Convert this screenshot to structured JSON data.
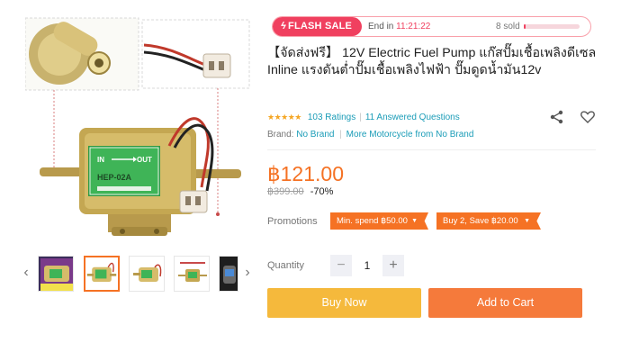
{
  "flash_sale": {
    "label": "FLASH SALE",
    "icon": "bolt-icon",
    "end_in_label": "End in",
    "timer": "11:21:22",
    "sold_text": "8 sold",
    "sold_fraction": 0.03,
    "accent_color": "#f0405f"
  },
  "product": {
    "title": "【จัดส่งฟรี】 12V Electric Fuel Pump แก๊สปั๊มเชื้อเพลิงดีเซล Inline แรงดันต่ำปั๊มเชื้อเพลิงไฟฟ้า ปั๊มดูดน้ำมัน12v",
    "rating_value": 4.5,
    "ratings_text": "103 Ratings",
    "questions_text": "11 Answered Questions",
    "brand_label": "Brand:",
    "brand_value": "No Brand",
    "more_link": "More Motorcycle from No Brand",
    "pump_label_in": "IN",
    "pump_label_out": "OUT",
    "pump_model": "HEP-02A"
  },
  "pricing": {
    "price": "฿121.00",
    "old_price": "฿399.00",
    "discount": "-70%",
    "accent_color": "#f57224"
  },
  "promotions": {
    "label": "Promotions",
    "tags": [
      "Min. spend ฿50.00",
      "Buy 2, Save ฿20.00"
    ]
  },
  "quantity": {
    "label": "Quantity",
    "value": "1",
    "minus": "−",
    "plus": "+"
  },
  "actions": {
    "buy_now": "Buy Now",
    "add_to_cart": "Add to Cart",
    "buy_now_color": "#f5b93c",
    "add_to_cart_color": "#f57a3b"
  },
  "gallery": {
    "thumbnail_count": 5,
    "active_index": 1,
    "prev_arrow": "‹",
    "next_arrow": "›"
  },
  "icons": {
    "share": "share-icon",
    "wishlist": "heart-icon",
    "stars": "star-icon"
  }
}
